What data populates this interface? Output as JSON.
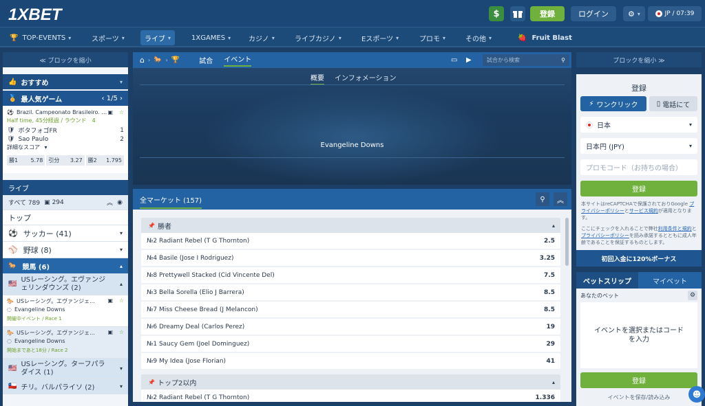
{
  "header": {
    "logo_main": "1X",
    "logo_accent": "BET",
    "dollar": "$",
    "register": "登録",
    "login": "ログイン",
    "locale": "JP / 07:39"
  },
  "nav": {
    "items": [
      "TOP-EVENTS",
      "スポーツ",
      "ライブ",
      "1XGAMES",
      "カジノ",
      "ライブカジノ",
      "Eスポーツ",
      "プロモ",
      "その他"
    ],
    "fruit": "Fruit Blast"
  },
  "left": {
    "collapse": "≪ ブロックを縮小",
    "recommended": "おすすめ",
    "popular": "最人気ゲーム",
    "pager": "1/5",
    "match": {
      "league": "Brazil. Campeonato Brasileiro. ...",
      "status": "Half time, 45分経過 / ラウンド　4",
      "team1": "ボタフォゴFR",
      "score1": "1",
      "team2": "Sao Paulo",
      "score2": "2",
      "detail": "詳細なスコア",
      "odds": [
        {
          "l": "勝1",
          "v": "5.78"
        },
        {
          "l": "引分",
          "v": "3.27"
        },
        {
          "l": "勝2",
          "v": "1.795"
        }
      ]
    },
    "live": "ライブ",
    "all_label": "すべて 789",
    "all_stream": "294",
    "top": "トップ",
    "sports": [
      {
        "name": "サッカー (41)"
      },
      {
        "name": "野球 (8)"
      }
    ],
    "horse": "競馬 (6)",
    "us_racing": "USレーシング。エヴァンジェリンダウンズ (2)",
    "events": [
      {
        "t": "USレーシング。エヴァンジェ...",
        "n": "Evangeline Downs",
        "s": "開催中イベント / Race 1"
      },
      {
        "t": "USレーシング。エヴァンジェ...",
        "n": "Evangeline Downs",
        "s": "開始まであと18分 / Race 2"
      }
    ],
    "turf": "USレーシング。ターフパラダイス (1)",
    "chile": "チリ。バルパライソ (2)"
  },
  "center": {
    "tabs": [
      "試合",
      "イベント"
    ],
    "search_placeholder": "試合から検索",
    "subtabs": [
      "概要",
      "インフォメーション"
    ],
    "event_title": "Evangeline Downs",
    "markets_label": "全マーケット (157)",
    "group1": "勝者",
    "runners": [
      {
        "n": "№2 Radiant Rebel (T G Thornton)",
        "v": "2.5"
      },
      {
        "n": "№4 Basile (Jose I Rodriguez)",
        "v": "3.25"
      },
      {
        "n": "№8 Prettywell Stacked (Cid Vincente Del)",
        "v": "7.5"
      },
      {
        "n": "№3 Bella Sorella (Elio J Barrera)",
        "v": "8.5"
      },
      {
        "n": "№7 Miss Cheese Bread (J Melancon)",
        "v": "8.5"
      },
      {
        "n": "№6 Dreamy Deal (Carlos Perez)",
        "v": "19"
      },
      {
        "n": "№1 Saucy Gem (Joel Dominguez)",
        "v": "29"
      },
      {
        "n": "№9 My Idea (Jose Florian)",
        "v": "41"
      }
    ],
    "group2": "トップ2以内",
    "runner2": {
      "n": "№2 Radiant Rebel (T G Thornton)",
      "v": "1.336"
    }
  },
  "right": {
    "collapse": "ブロックを縮小 ≫",
    "reg_title": "登録",
    "one_click": "ワンクリック",
    "by_phone": "電話にて",
    "country": "日本",
    "currency": "日本円 (JPY)",
    "promo_placeholder": "プロモコード（お持ちの場合）",
    "register_btn": "登録",
    "recaptcha1": "本サイトはreCAPTCHAで保護されておりGoogle ",
    "privacy": "プライバシーポリシー",
    "and": "と",
    "terms": "サービス規約",
    "recaptcha2": "が適用となります。",
    "consent1": "ここにチェックを入れることで弊社",
    "consent_terms": "利用条件と規約",
    "consent2": "と",
    "consent_privacy": "プライバシーポリシー",
    "consent3": "を読み承諾するとともに成人年齢であることを保証するものとします。",
    "bonus": "初回入金に120%ボーナス",
    "betslip": "ベットスリップ",
    "mybets": "マイベット",
    "your_bet": "あなたのベット",
    "empty": "イベントを選択またはコードを入力",
    "register_btn2": "登録",
    "save": "イベントを保存/読み込み"
  }
}
